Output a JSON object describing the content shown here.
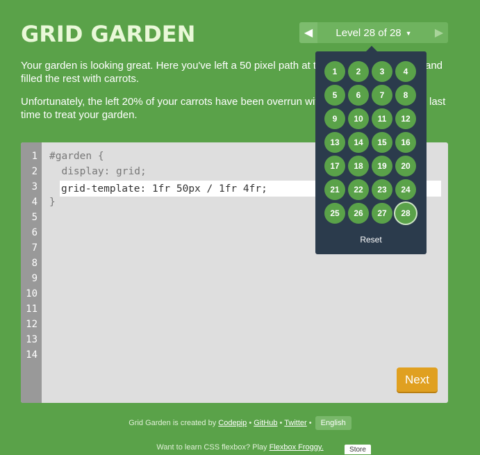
{
  "app": {
    "title": "GRID GARDEN"
  },
  "level_nav": {
    "prev_icon": "triangle-left-icon",
    "next_icon": "triangle-right-icon",
    "label": "Level 28 of 28",
    "caret_glyph": "▼"
  },
  "intro": {
    "paragraph1": "Your garden is looking great. Here you've left a 50 pixel path at the",
    "paragraph1_end": "and",
    "paragraph1_line2": "filled the rest with carrots.",
    "paragraph2": "Unfortunately, the left 20% of your carrots have been overrun with",
    "paragraph2_end": "last",
    "paragraph2_line2": "time to treat your garden."
  },
  "editor": {
    "line_numbers": [
      "1",
      "2",
      "3",
      "4",
      "5",
      "6",
      "7",
      "8",
      "9",
      "10",
      "11",
      "12",
      "13",
      "14"
    ],
    "line1": "#garden {",
    "line2": "  display: grid;",
    "input_value": "grid-template: 1fr 50px / 1fr 4fr;",
    "line4": "}"
  },
  "next_button": {
    "label": "Next"
  },
  "level_dropdown": {
    "levels": [
      "1",
      "2",
      "3",
      "4",
      "5",
      "6",
      "7",
      "8",
      "9",
      "10",
      "11",
      "12",
      "13",
      "14",
      "15",
      "16",
      "17",
      "18",
      "19",
      "20",
      "21",
      "22",
      "23",
      "24",
      "25",
      "26",
      "27",
      "28"
    ],
    "current_level": "28",
    "reset_label": "Reset"
  },
  "footer": {
    "created_by": "Grid Garden is created by",
    "codepip": "Codepip",
    "sep": "•",
    "github": "GitHub",
    "twitter": "Twitter",
    "language": "English",
    "flexbox_prompt": "Want to learn CSS flexbox? Play",
    "flexbox_link": "Flexbox Froggy.",
    "store_label": "Store"
  },
  "colors": {
    "background": "#5aa249",
    "dropdown_bg": "#2b3b4c",
    "next_button": "#e0a020",
    "level_button": "#5aa249"
  }
}
